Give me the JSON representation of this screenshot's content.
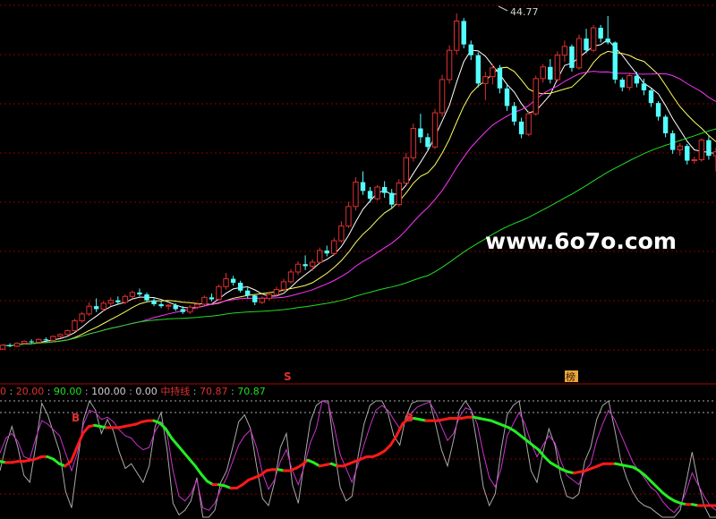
{
  "colors": {
    "background": "#000000",
    "grid": "#8b0000",
    "up_candle": "#e03030",
    "down_candle": "#54ffff",
    "ma_short": "#ffffff",
    "ma_mid": "#ffff60",
    "ma_long": "#ff33ff",
    "ma_xlong": "#22dd22",
    "indicator_bull": "#ff1a1a",
    "indicator_bear": "#22ee22",
    "indicator_fast": "#cc33cc",
    "indicator_slow": "#aaaaaa",
    "marker_gold": "#e6a73c"
  },
  "main_panel": {
    "peak_label": "44.77",
    "watermark": "www.6o7o.com",
    "signal_s": "S",
    "signal_bang": "榜"
  },
  "indicator_header": {
    "items": [
      {
        "text": "0",
        "color": "#e03030"
      },
      {
        "text": " : ",
        "color": "#aaaaaa"
      },
      {
        "text": "20.00",
        "color": "#e03030"
      },
      {
        "text": " : ",
        "color": "#aaaaaa"
      },
      {
        "text": "90.00",
        "color": "#22dd22"
      },
      {
        "text": " : ",
        "color": "#aaaaaa"
      },
      {
        "text": "100.00",
        "color": "#cfcfcf"
      },
      {
        "text": " : ",
        "color": "#aaaaaa"
      },
      {
        "text": "0.00",
        "color": "#cfcfcf"
      },
      {
        "text": "  ",
        "color": "#aaaaaa"
      },
      {
        "text": "中持线",
        "color": "#e03030"
      },
      {
        "text": " : ",
        "color": "#aaaaaa"
      },
      {
        "text": "70.87",
        "color": "#e03030"
      },
      {
        "text": " : ",
        "color": "#aaaaaa"
      },
      {
        "text": "70.87",
        "color": "#22dd22"
      }
    ],
    "buy_marker": "B"
  },
  "chart_data": [
    {
      "type": "candlestick",
      "title": "",
      "peak_value": 44.77,
      "ohlc": [
        [
          10.4,
          10.9,
          10.3,
          10.8
        ],
        [
          10.8,
          11.0,
          10.6,
          10.7
        ],
        [
          10.7,
          11.1,
          10.6,
          11.0
        ],
        [
          11.0,
          11.3,
          10.9,
          11.2
        ],
        [
          11.2,
          11.4,
          11.0,
          11.1
        ],
        [
          11.1,
          11.5,
          11.0,
          11.4
        ],
        [
          11.4,
          11.6,
          11.2,
          11.3
        ],
        [
          11.3,
          11.8,
          11.2,
          11.7
        ],
        [
          11.7,
          12.0,
          11.5,
          11.9
        ],
        [
          11.9,
          12.4,
          11.8,
          12.3
        ],
        [
          12.3,
          13.5,
          12.2,
          13.3
        ],
        [
          13.3,
          14.2,
          13.1,
          14.0
        ],
        [
          14.0,
          15.2,
          13.8,
          14.8
        ],
        [
          14.8,
          15.6,
          14.2,
          14.5
        ],
        [
          14.5,
          15.3,
          14.3,
          15.1
        ],
        [
          15.1,
          15.7,
          14.8,
          15.4
        ],
        [
          15.4,
          15.8,
          15.0,
          15.2
        ],
        [
          15.2,
          16.0,
          15.0,
          15.8
        ],
        [
          15.8,
          16.4,
          15.6,
          16.2
        ],
        [
          16.2,
          16.6,
          15.8,
          16.0
        ],
        [
          16.0,
          16.2,
          15.2,
          15.4
        ],
        [
          15.4,
          15.6,
          14.8,
          15.0
        ],
        [
          15.0,
          15.3,
          14.6,
          14.8
        ],
        [
          14.8,
          15.0,
          14.4,
          14.9
        ],
        [
          14.9,
          15.1,
          14.3,
          14.5
        ],
        [
          14.5,
          14.8,
          14.0,
          14.2
        ],
        [
          14.2,
          14.9,
          14.0,
          14.7
        ],
        [
          14.7,
          15.2,
          14.5,
          15.0
        ],
        [
          15.0,
          15.9,
          14.9,
          15.7
        ],
        [
          15.7,
          16.1,
          15.3,
          15.5
        ],
        [
          15.5,
          17.0,
          15.4,
          16.8
        ],
        [
          16.8,
          18.2,
          16.5,
          17.6
        ],
        [
          17.6,
          17.9,
          16.9,
          17.2
        ],
        [
          17.2,
          17.4,
          16.2,
          16.4
        ],
        [
          16.4,
          16.7,
          15.6,
          15.9
        ],
        [
          15.9,
          16.0,
          14.9,
          15.2
        ],
        [
          15.2,
          15.8,
          15.0,
          15.6
        ],
        [
          15.6,
          16.2,
          15.4,
          16.0
        ],
        [
          16.0,
          16.8,
          15.8,
          16.5
        ],
        [
          16.5,
          17.6,
          16.3,
          17.3
        ],
        [
          17.3,
          18.6,
          17.1,
          18.3
        ],
        [
          18.3,
          19.4,
          18.0,
          19.1
        ],
        [
          19.1,
          20.0,
          18.5,
          18.9
        ],
        [
          18.9,
          19.6,
          18.4,
          19.3
        ],
        [
          19.3,
          20.8,
          19.1,
          20.5
        ],
        [
          20.5,
          21.0,
          19.9,
          20.2
        ],
        [
          20.2,
          21.8,
          20.0,
          21.5
        ],
        [
          21.5,
          23.5,
          21.3,
          23.0
        ],
        [
          23.0,
          25.5,
          22.8,
          25.0
        ],
        [
          25.0,
          28.0,
          24.6,
          27.5
        ],
        [
          27.5,
          28.6,
          26.2,
          26.6
        ],
        [
          26.6,
          27.0,
          25.4,
          25.8
        ],
        [
          25.8,
          27.2,
          25.6,
          27.0
        ],
        [
          27.0,
          27.6,
          25.9,
          26.4
        ],
        [
          26.4,
          26.8,
          24.8,
          25.2
        ],
        [
          25.2,
          27.8,
          25.0,
          27.4
        ],
        [
          27.4,
          30.5,
          27.2,
          30.0
        ],
        [
          30.0,
          33.5,
          29.6,
          33.0
        ],
        [
          33.0,
          34.5,
          31.5,
          32.1
        ],
        [
          32.1,
          32.5,
          30.8,
          31.1
        ],
        [
          31.1,
          35.0,
          30.9,
          34.6
        ],
        [
          34.6,
          38.5,
          34.2,
          38.0
        ],
        [
          38.0,
          41.5,
          37.6,
          41.0
        ],
        [
          41.0,
          44.77,
          40.6,
          44.0
        ],
        [
          44.0,
          44.3,
          41.2,
          41.6
        ],
        [
          41.6,
          42.0,
          40.0,
          40.5
        ],
        [
          40.5,
          40.8,
          37.2,
          37.6
        ],
        [
          37.6,
          38.8,
          35.9,
          38.3
        ],
        [
          38.3,
          39.6,
          37.5,
          39.2
        ],
        [
          39.2,
          39.5,
          36.6,
          37.1
        ],
        [
          37.1,
          37.6,
          34.8,
          35.3
        ],
        [
          35.3,
          35.7,
          33.3,
          33.7
        ],
        [
          33.7,
          34.1,
          32.0,
          32.4
        ],
        [
          32.4,
          34.8,
          32.2,
          34.5
        ],
        [
          34.5,
          38.4,
          34.3,
          38.1
        ],
        [
          38.1,
          39.6,
          37.7,
          39.3
        ],
        [
          39.3,
          40.1,
          37.6,
          38.0
        ],
        [
          38.0,
          40.9,
          37.8,
          40.5
        ],
        [
          40.5,
          42.0,
          39.8,
          41.4
        ],
        [
          41.4,
          41.6,
          38.8,
          39.2
        ],
        [
          39.2,
          42.6,
          39.0,
          42.2
        ],
        [
          42.2,
          43.2,
          40.7,
          41.0
        ],
        [
          41.0,
          43.6,
          40.8,
          43.3
        ],
        [
          43.3,
          43.6,
          41.8,
          42.2
        ],
        [
          42.2,
          44.5,
          41.6,
          41.8
        ],
        [
          41.8,
          41.9,
          37.6,
          38.0
        ],
        [
          38.0,
          38.2,
          36.8,
          37.2
        ],
        [
          37.2,
          38.6,
          36.9,
          38.4
        ],
        [
          38.4,
          38.8,
          37.2,
          37.6
        ],
        [
          37.6,
          38.1,
          36.4,
          36.9
        ],
        [
          36.9,
          37.1,
          35.2,
          35.6
        ],
        [
          35.6,
          35.8,
          33.8,
          34.2
        ],
        [
          34.2,
          34.4,
          32.1,
          32.5
        ],
        [
          32.5,
          32.8,
          30.4,
          30.8
        ],
        [
          30.8,
          31.5,
          30.2,
          31.2
        ],
        [
          31.2,
          31.4,
          29.3,
          29.7
        ],
        [
          29.7,
          30.1,
          29.4,
          29.8
        ],
        [
          29.8,
          32.0,
          29.6,
          31.8
        ],
        [
          31.8,
          32.2,
          29.8,
          30.2
        ],
        [
          30.2,
          31.0,
          28.6,
          30.6
        ]
      ]
    },
    {
      "type": "line",
      "title": "",
      "ylim": [
        0,
        100
      ],
      "levels": [
        20,
        90,
        100,
        0
      ],
      "legend_values": [
        70.87,
        70.87
      ],
      "series": [
        {
          "values": [
            48,
            47,
            47,
            48,
            48,
            49,
            50,
            52,
            52,
            50,
            46,
            44,
            48,
            60,
            72,
            78,
            79,
            78,
            77,
            77,
            77,
            78,
            79,
            80,
            82,
            83,
            83,
            81,
            76,
            68,
            62,
            56,
            50,
            44,
            37,
            31,
            28,
            28,
            27,
            25,
            25,
            28,
            32,
            34,
            36,
            40,
            41,
            41,
            40,
            40,
            42,
            45,
            49,
            47,
            44,
            45,
            46,
            44,
            44,
            46,
            48,
            50,
            52,
            52,
            54,
            57,
            62,
            70,
            80,
            85,
            85,
            84,
            83,
            83,
            83,
            84,
            85,
            85,
            85,
            86,
            86,
            85,
            84,
            83,
            81,
            79,
            77,
            74,
            70,
            66,
            62,
            58,
            52,
            47,
            44,
            41,
            39,
            38,
            39,
            40,
            42,
            44,
            46,
            46,
            46,
            45,
            44,
            43,
            40,
            36,
            31,
            26,
            21,
            17,
            14,
            12,
            11,
            11,
            10,
            10,
            10,
            10
          ]
        },
        {
          "values": [
            55,
            68,
            72,
            65,
            52,
            50,
            68,
            83,
            80,
            75,
            70,
            55,
            40,
            56,
            80,
            92,
            90,
            84,
            86,
            82,
            75,
            70,
            68,
            62,
            58,
            60,
            74,
            82,
            72,
            40,
            18,
            14,
            20,
            32,
            8,
            6,
            12,
            24,
            34,
            48,
            62,
            70,
            75,
            60,
            38,
            24,
            32,
            48,
            58,
            40,
            28,
            44,
            64,
            76,
            100,
            98,
            78,
            54,
            42,
            30,
            45,
            62,
            78,
            92,
            96,
            92,
            84,
            76,
            82,
            90,
            95,
            97,
            99,
            90,
            78,
            66,
            72,
            86,
            94,
            92,
            80,
            55,
            34,
            26,
            42,
            70,
            80,
            90,
            80,
            64,
            52,
            62,
            70,
            64,
            48,
            36,
            32,
            28,
            40,
            46,
            66,
            80,
            92,
            84,
            72,
            60,
            48,
            40,
            34,
            26,
            22,
            14,
            8,
            4,
            10,
            22,
            38,
            28,
            18,
            10,
            6
          ]
        },
        {
          "values": [
            40,
            62,
            78,
            60,
            36,
            30,
            62,
            98,
            88,
            72,
            56,
            22,
            8,
            48,
            84,
            100,
            92,
            72,
            84,
            74,
            56,
            42,
            46,
            38,
            30,
            44,
            78,
            90,
            58,
            12,
            2,
            6,
            14,
            34,
            0,
            0,
            6,
            30,
            40,
            60,
            82,
            88,
            76,
            44,
            16,
            10,
            30,
            60,
            72,
            28,
            12,
            48,
            82,
            96,
            100,
            100,
            60,
            26,
            14,
            18,
            52,
            80,
            96,
            100,
            100,
            90,
            70,
            62,
            86,
            98,
            100,
            100,
            100,
            80,
            58,
            44,
            66,
            92,
            100,
            92,
            62,
            26,
            10,
            20,
            58,
            88,
            96,
            100,
            70,
            40,
            30,
            56,
            76,
            62,
            34,
            18,
            16,
            20,
            48,
            60,
            84,
            96,
            100,
            76,
            50,
            34,
            22,
            14,
            10,
            8,
            4,
            0,
            0,
            0,
            6,
            30,
            56,
            30,
            10,
            0,
            0
          ]
        }
      ]
    }
  ]
}
